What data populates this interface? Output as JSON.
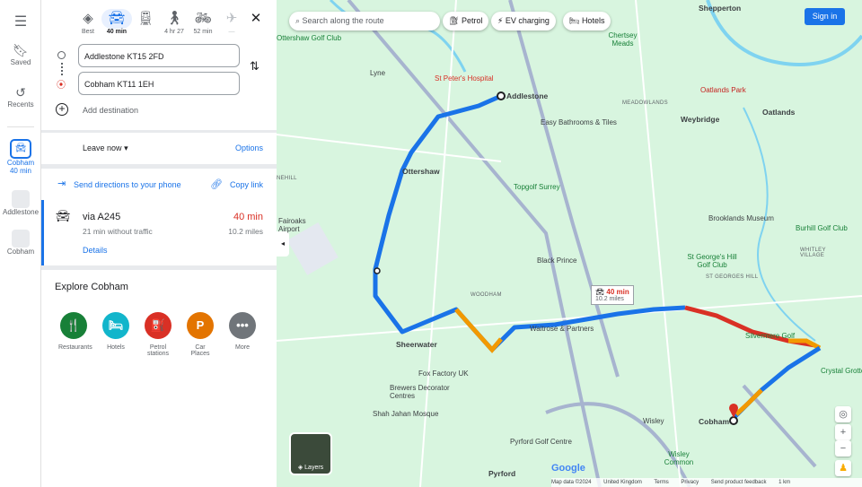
{
  "rail": {
    "saved": "Saved",
    "recents": "Recents",
    "items": [
      {
        "label": "Cobham",
        "sub": "40 min"
      },
      {
        "label": "Addlestone"
      },
      {
        "label": "Cobham"
      }
    ]
  },
  "modes": [
    {
      "icon": "best-route-icon",
      "label": "Best"
    },
    {
      "icon": "car-icon",
      "label": "40 min"
    },
    {
      "icon": "train-icon",
      "label": ""
    },
    {
      "icon": "walk-icon",
      "label": "4 hr 27"
    },
    {
      "icon": "bike-icon",
      "label": "52 min"
    },
    {
      "icon": "plane-icon",
      "label": "—"
    }
  ],
  "origin": "Addlestone KT15 2FD",
  "destination": "Cobham KT11 1EH",
  "add_destination": "Add destination",
  "leave_now": "Leave now",
  "options": "Options",
  "send_directions": "Send directions to your phone",
  "copy_link": "Copy link",
  "route": {
    "via": "via A245",
    "time": "40 min",
    "no_traffic": "21 min without traffic",
    "distance": "10.2 miles",
    "details": "Details"
  },
  "explore": {
    "title": "Explore Cobham",
    "items": [
      {
        "label": "Restaurants",
        "color": "#188038",
        "icon": "🍴"
      },
      {
        "label": "Hotels",
        "color": "#12b5cb",
        "icon": "🛏"
      },
      {
        "label": "Petrol stations",
        "color": "#d93025",
        "icon": "⛽"
      },
      {
        "label": "Car Places",
        "color": "#e37400",
        "icon": "P"
      },
      {
        "label": "More",
        "color": "#70757a",
        "icon": "•••"
      }
    ]
  },
  "map": {
    "search_placeholder": "Search along the route",
    "chips": [
      "Petrol",
      "EV charging",
      "Hotels"
    ],
    "sign_in": "Sign in",
    "layers": "Layers",
    "route_label": {
      "time": "40 min",
      "distance": "10.2 miles"
    },
    "labels": [
      "Shepperton",
      "Chertsey Meads",
      "Lyne",
      "St Peter's Hospital",
      "Addlestone",
      "Oatlands Park",
      "MEADOWLANDS",
      "Easy Bathrooms & Tiles",
      "Weybridge",
      "Oatlands",
      "Ottershaw",
      "Topgolf Surrey",
      "Brooklands Museum",
      "Burhill Golf Club",
      "Fairoaks Airport",
      "Black Prince",
      "St George's Hill Golf Club",
      "ST GEORGES HILL",
      "WHITLEY VILLAGE",
      "WOODHAM",
      "Sheerwater",
      "Waitrose & Partners",
      "Silvermere Golf",
      "Crystal Grotto",
      "Fox Factory UK",
      "Brewers Decorator Centres",
      "Shah Jahan Mosque",
      "Wisley",
      "Cobham",
      "Pyrford Golf Centre",
      "Pyrford",
      "Wisley Common",
      "Ottershaw Golf Club",
      "NEHILL"
    ],
    "footer": [
      "Map data ©2024",
      "United Kingdom",
      "Terms",
      "Privacy",
      "Send product feedback",
      "1 km"
    ],
    "colors": {
      "route": "#1a73e8",
      "slow": "#f29900",
      "jam": "#d93025"
    }
  }
}
